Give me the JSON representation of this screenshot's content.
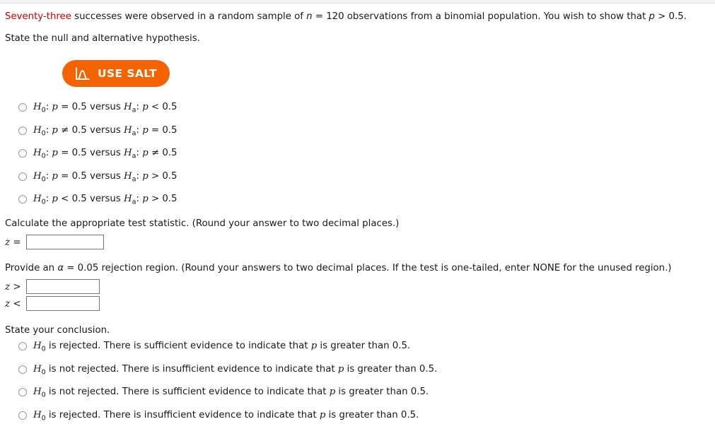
{
  "page": {
    "question_intro_emphasis": "Seventy-three",
    "question_intro_rest": " successes were observed in a random sample of ",
    "n_symbol": "n",
    "n_eq": " = 120 observations from a binomial population. You wish to show that ",
    "p_symbol": "p",
    "p_rest": " > 0.5.",
    "state_hypothesis_text": "State the null and alternative hypothesis."
  },
  "salt_button": {
    "label": "USE SALT",
    "icon": "distribution-curve-icon",
    "background_color": "#f56300",
    "text_color": "#ffffff"
  },
  "hypothesis_options": [
    {
      "id": "h1",
      "h0_sub": "0",
      "h0_rel": "=",
      "h0_val": "0.5",
      "ha_sub": "a",
      "ha_rel": "<",
      "ha_val": "0.5",
      "versus": "versus"
    },
    {
      "id": "h2",
      "h0_sub": "0",
      "h0_rel": "≠",
      "h0_val": "0.5",
      "ha_sub": "a",
      "ha_rel": "=",
      "ha_val": "0.5",
      "versus": "versus"
    },
    {
      "id": "h3",
      "h0_sub": "0",
      "h0_rel": "=",
      "h0_val": "0.5",
      "ha_sub": "a",
      "ha_rel": "≠",
      "ha_val": "0.5",
      "versus": "versus"
    },
    {
      "id": "h4",
      "h0_sub": "0",
      "h0_rel": "=",
      "h0_val": "0.5",
      "ha_sub": "a",
      "ha_rel": ">",
      "ha_val": "0.5",
      "versus": "versus"
    },
    {
      "id": "h5",
      "h0_sub": "0",
      "h0_rel": "<",
      "h0_val": "0.5",
      "ha_sub": "a",
      "ha_rel": ">",
      "ha_val": "0.5",
      "versus": "versus"
    }
  ],
  "test_statistic": {
    "instruction": "Calculate the appropriate test statistic. (Round your answer to two decimal places.)",
    "label_var": "z",
    "label_op": "=",
    "value": "",
    "placeholder": ""
  },
  "rejection_region": {
    "instruction_a": "Provide an ",
    "alpha_symbol": "α",
    "instruction_b": " = 0.05 rejection region. (Round your answers to two decimal places. If the test is one-tailed, enter NONE for the unused region.)",
    "rows": [
      {
        "label_var": "z",
        "label_op": ">",
        "value": "",
        "placeholder": ""
      },
      {
        "label_var": "z",
        "label_op": "<",
        "value": "",
        "placeholder": ""
      }
    ]
  },
  "conclusion": {
    "instruction": "State your conclusion.",
    "options": [
      {
        "id": "c1",
        "h_sub": "0",
        "text": " is rejected. There is sufficient evidence to indicate that ",
        "var": "p",
        "tail": " is greater than 0.5."
      },
      {
        "id": "c2",
        "h_sub": "0",
        "text": " is not rejected. There is insufficient evidence to indicate that ",
        "var": "p",
        "tail": " is greater than 0.5."
      },
      {
        "id": "c3",
        "h_sub": "0",
        "text": " is not rejected. There is sufficient evidence to indicate that ",
        "var": "p",
        "tail": " is greater than 0.5."
      },
      {
        "id": "c4",
        "h_sub": "0",
        "text": " is rejected. There is insufficient evidence to indicate that ",
        "var": "p",
        "tail": " is greater than 0.5."
      }
    ]
  },
  "colors": {
    "emphasis_red": "#cc0000",
    "salt_orange": "#f56300",
    "input_border": "#767676",
    "radio_border": "#9a9a9a",
    "topbar": "#f2f2f2"
  }
}
